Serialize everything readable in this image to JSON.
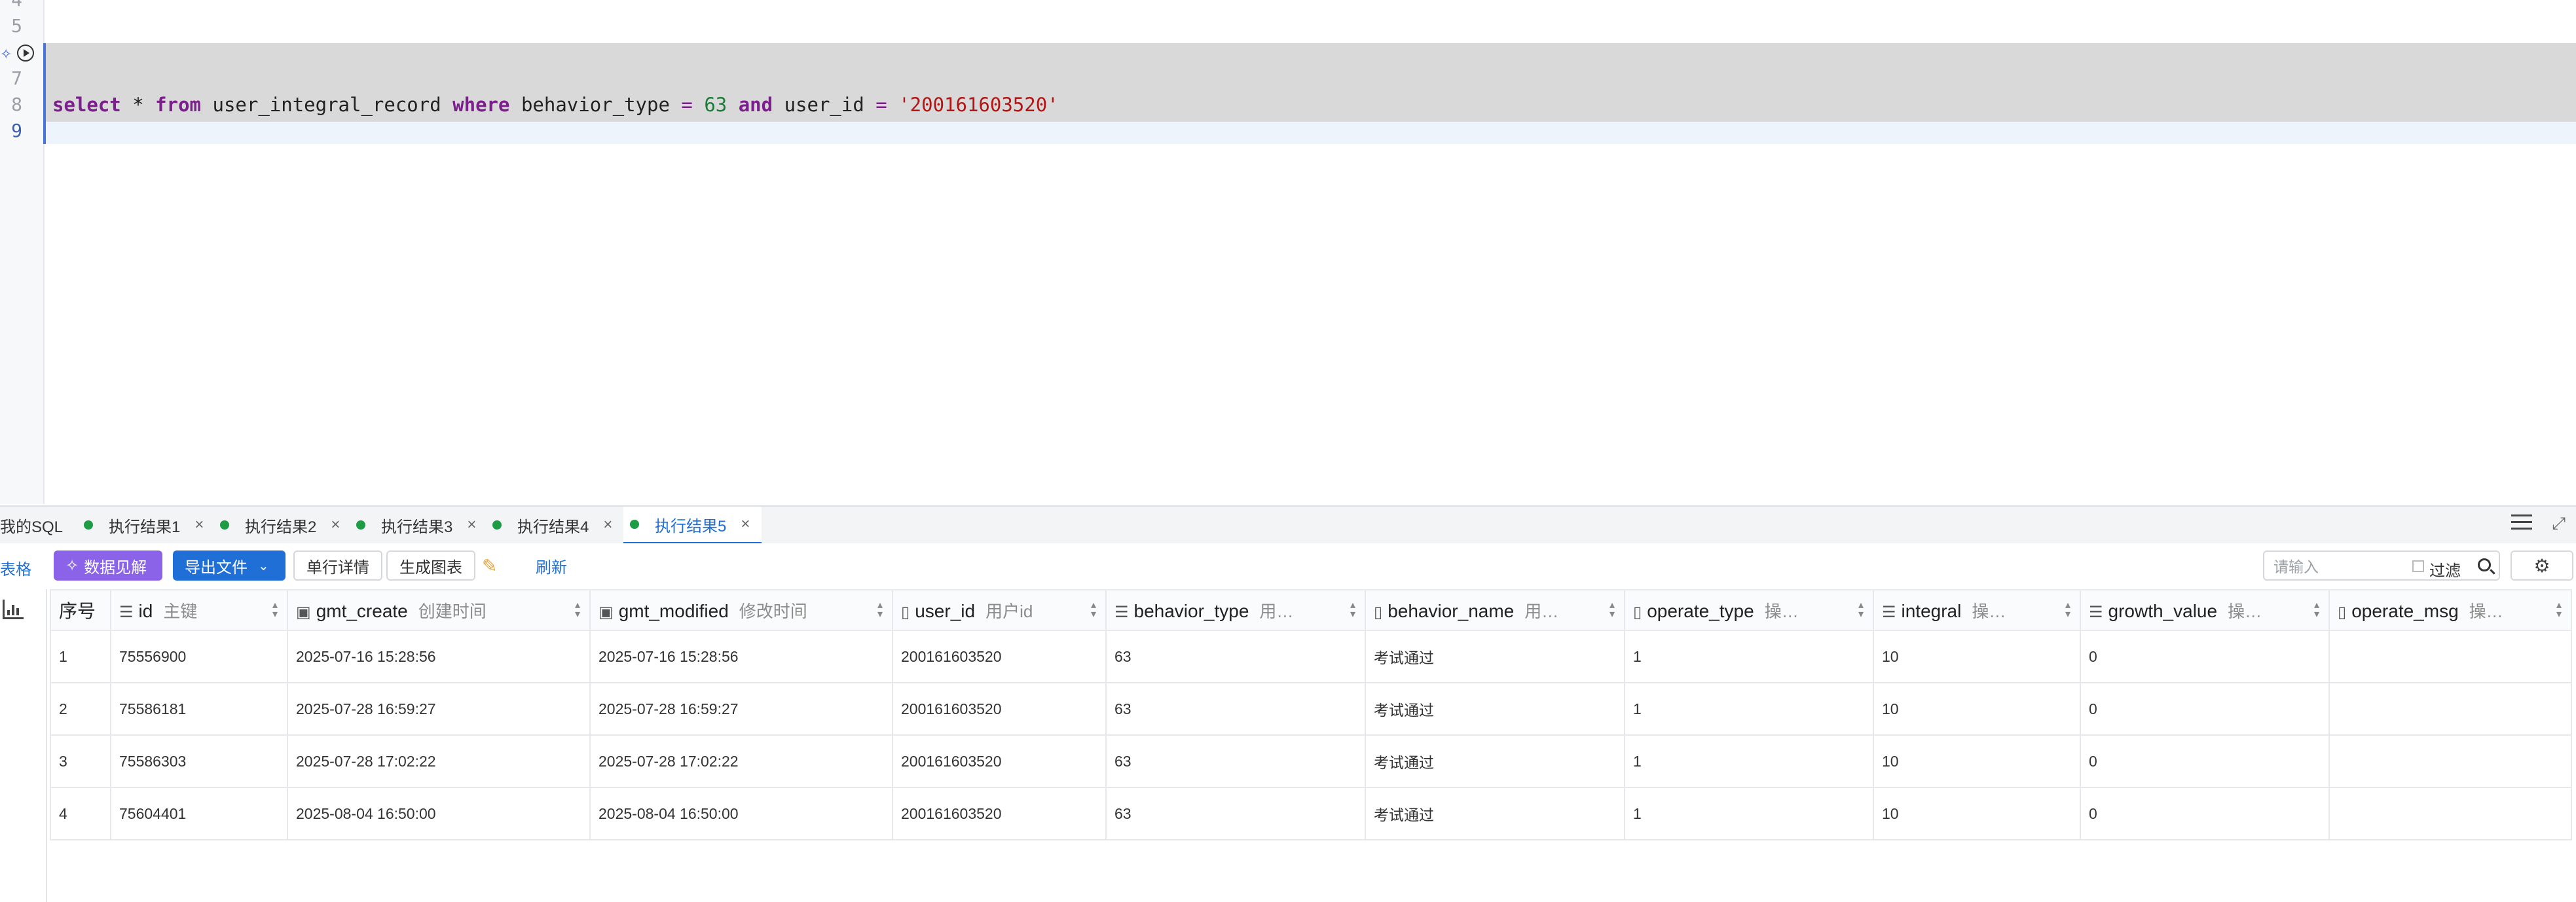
{
  "editor": {
    "line_numbers": [
      "4",
      "5",
      "",
      "7",
      "8",
      "9"
    ],
    "sql": {
      "k_select": "select",
      "star": "*",
      "k_from": "from",
      "table": "user_integral_record",
      "k_where": "where",
      "col1": "behavior_type",
      "eq1": "=",
      "val1": "63",
      "k_and": "and",
      "col2": "user_id",
      "eq2": "=",
      "val2": "'200161603520'"
    }
  },
  "tabs": {
    "my_sql": "我的SQL",
    "results": [
      "执行结果1",
      "执行结果2",
      "执行结果3",
      "执行结果4",
      "执行结果5"
    ],
    "close": "×"
  },
  "toolbar": {
    "left_label": "表格",
    "insight": "数据见解",
    "export": "导出文件",
    "row_detail": "单行详情",
    "gen_chart": "生成图表",
    "refresh": "刷新",
    "search_placeholder": "请输入",
    "filter": "过滤"
  },
  "grid": {
    "columns": [
      {
        "name": "序号",
        "comment": ""
      },
      {
        "name": "id",
        "comment": "主键"
      },
      {
        "name": "gmt_create",
        "comment": "创建时间"
      },
      {
        "name": "gmt_modified",
        "comment": "修改时间"
      },
      {
        "name": "user_id",
        "comment": "用户id"
      },
      {
        "name": "behavior_type",
        "comment": "用…"
      },
      {
        "name": "behavior_name",
        "comment": "用…"
      },
      {
        "name": "operate_type",
        "comment": "操…"
      },
      {
        "name": "integral",
        "comment": "操…"
      },
      {
        "name": "growth_value",
        "comment": "操…"
      },
      {
        "name": "operate_msg",
        "comment": "操…"
      }
    ],
    "rows": [
      [
        "1",
        "75556900",
        "2025-07-16 15:28:56",
        "2025-07-16 15:28:56",
        "200161603520",
        "63",
        "考试通过",
        "1",
        "10",
        "0",
        ""
      ],
      [
        "2",
        "75586181",
        "2025-07-28 16:59:27",
        "2025-07-28 16:59:27",
        "200161603520",
        "63",
        "考试通过",
        "1",
        "10",
        "0",
        ""
      ],
      [
        "3",
        "75586303",
        "2025-07-28 17:02:22",
        "2025-07-28 17:02:22",
        "200161603520",
        "63",
        "考试通过",
        "1",
        "10",
        "0",
        ""
      ],
      [
        "4",
        "75604401",
        "2025-08-04 16:50:00",
        "2025-08-04 16:50:00",
        "200161603520",
        "63",
        "考试通过",
        "1",
        "10",
        "0",
        ""
      ]
    ]
  },
  "colors": {
    "accent": "#1f6fd6",
    "insight": "#8a63e8",
    "status_dot": "#1e9b45",
    "keyword": "#7a1f8c",
    "number": "#1c7c3a",
    "string": "#b31515"
  }
}
